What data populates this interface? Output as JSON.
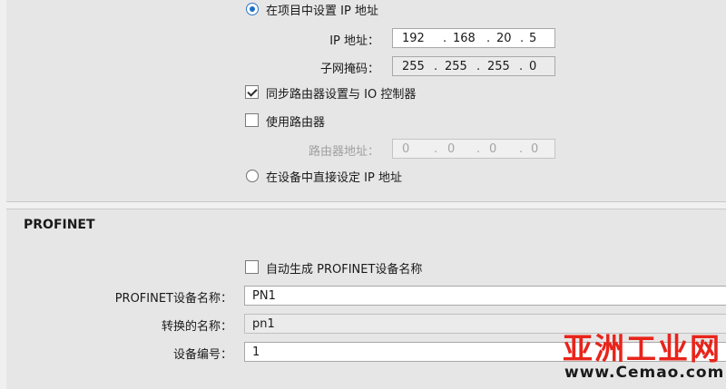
{
  "ip_section": {
    "radio_project_label": "在项目中设置 IP 地址",
    "ip_address_label": "IP 地址：",
    "ip_address": [
      "192",
      "168",
      "20",
      "5"
    ],
    "subnet_label": "子网掩码：",
    "subnet": [
      "255",
      "255",
      "255",
      "0"
    ],
    "sync_router_label": "同步路由器设置与 IO 控制器",
    "sync_router_checked": true,
    "use_router_label": "使用路由器",
    "use_router_checked": false,
    "router_address_label": "路由器地址：",
    "router_address": [
      "0",
      "0",
      "0",
      "0"
    ],
    "radio_device_label": "在设备中直接设定 IP 地址",
    "selected_radio": "project"
  },
  "profinet_section": {
    "title": "PROFINET",
    "auto_generate_label": "自动生成 PROFINET设备名称",
    "auto_generate_checked": false,
    "device_name_label": "PROFINET设备名称：",
    "device_name": "PN1",
    "converted_name_label": "转换的名称：",
    "converted_name": "pn1",
    "device_number_label": "设备编号：",
    "device_number": "1"
  },
  "watermark": {
    "brand": "亚洲工业网",
    "url": "www.Cemao.com",
    "brand_color": "#e8241b"
  }
}
